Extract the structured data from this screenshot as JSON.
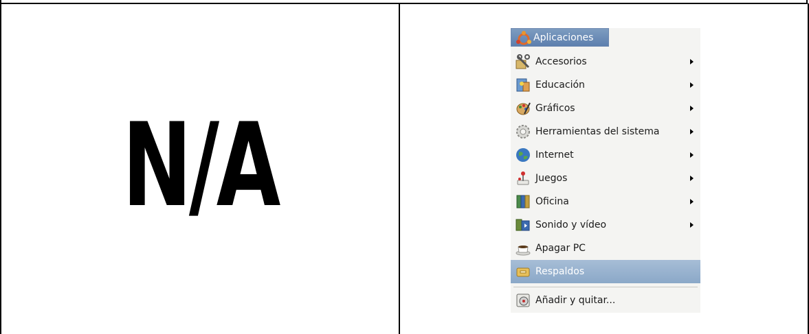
{
  "left_cell": {
    "text": "N/A"
  },
  "menu": {
    "header": {
      "label": "Aplicaciones",
      "icon": "ubuntu-logo-icon"
    },
    "items": [
      {
        "label": "Accesorios",
        "icon": "accessories-icon",
        "submenu": true,
        "selected": false
      },
      {
        "label": "Educación",
        "icon": "education-icon",
        "submenu": true,
        "selected": false
      },
      {
        "label": "Gráficos",
        "icon": "graphics-icon",
        "submenu": true,
        "selected": false
      },
      {
        "label": "Herramientas del sistema",
        "icon": "system-tools-icon",
        "submenu": true,
        "selected": false
      },
      {
        "label": "Internet",
        "icon": "internet-globe-icon",
        "submenu": true,
        "selected": false
      },
      {
        "label": "Juegos",
        "icon": "games-joystick-icon",
        "submenu": true,
        "selected": false
      },
      {
        "label": "Oficina",
        "icon": "office-icon",
        "submenu": true,
        "selected": false
      },
      {
        "label": "Sonido y vídeo",
        "icon": "sound-video-icon",
        "submenu": true,
        "selected": false
      },
      {
        "label": "Apagar PC",
        "icon": "coffee-cup-icon",
        "submenu": false,
        "selected": false
      },
      {
        "label": "Respaldos",
        "icon": "backup-drawer-icon",
        "submenu": false,
        "selected": true
      },
      {
        "label": "Añadir y quitar...",
        "icon": "add-remove-disc-icon",
        "submenu": false,
        "selected": false
      }
    ]
  },
  "colors": {
    "header_bg": "#6d8cb8",
    "selected_bg": "#94afcd",
    "menu_bg": "#f4f4f2"
  }
}
